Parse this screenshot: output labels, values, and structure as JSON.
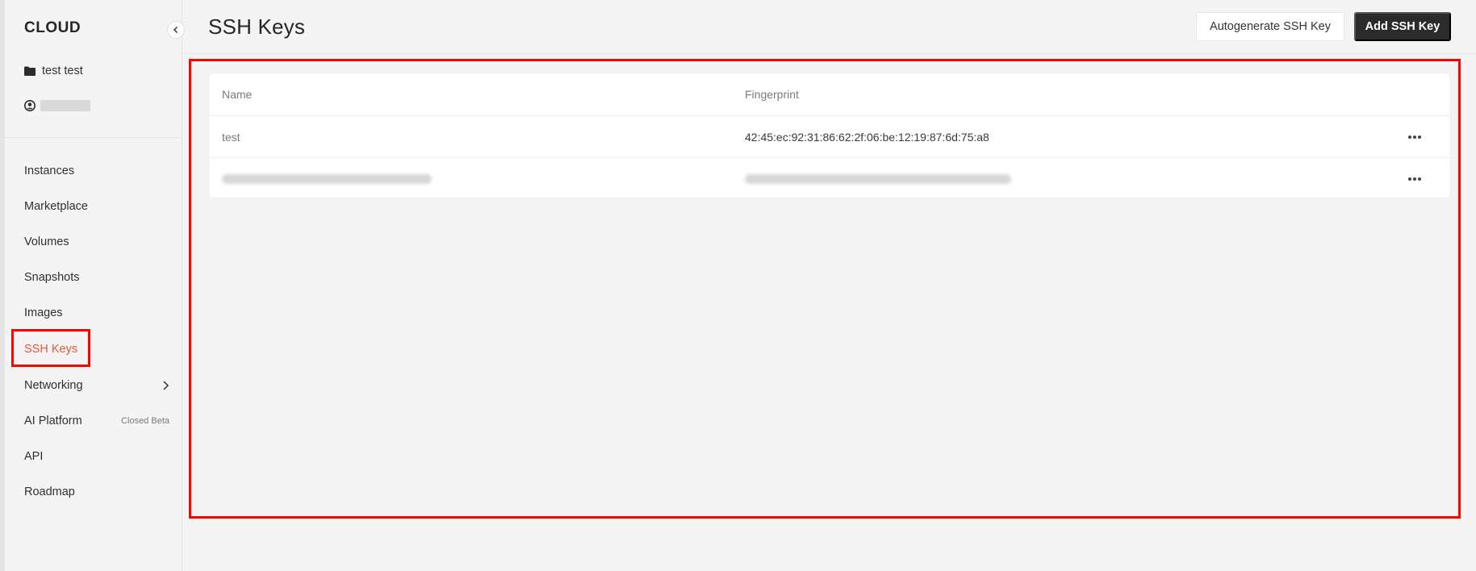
{
  "sidebar": {
    "brand": "CLOUD",
    "collapse_icon": "chevron-left-icon",
    "project": {
      "icon": "folder-icon",
      "name": "test test"
    },
    "account": {
      "icon": "user-circle-icon",
      "name": ""
    },
    "items": [
      {
        "label": "Instances"
      },
      {
        "label": "Marketplace"
      },
      {
        "label": "Volumes"
      },
      {
        "label": "Snapshots"
      },
      {
        "label": "Images"
      },
      {
        "label": "SSH Keys",
        "active": true
      },
      {
        "label": "Networking",
        "icon": "chevron-right-icon"
      },
      {
        "label": "AI Platform",
        "badge": "Closed Beta"
      },
      {
        "label": "API"
      },
      {
        "label": "Roadmap"
      }
    ]
  },
  "header": {
    "title": "SSH Keys",
    "autogenerate_label": "Autogenerate SSH Key",
    "add_label": "Add SSH Key"
  },
  "table": {
    "columns": {
      "name": "Name",
      "fingerprint": "Fingerprint"
    },
    "rows": [
      {
        "name": "test",
        "fingerprint": "42:45:ec:92:31:86:62:2f:06:be:12:19:87:6d:75:a8",
        "actions_icon": "more-horizontal-icon"
      },
      {
        "name": "",
        "fingerprint": "",
        "redacted": true,
        "actions_icon": "more-horizontal-icon"
      }
    ]
  },
  "colors": {
    "accent": "#e8553b",
    "primary_button": "#2b2b2b",
    "highlight": "#ff0000",
    "background": "#f4f4f4"
  }
}
